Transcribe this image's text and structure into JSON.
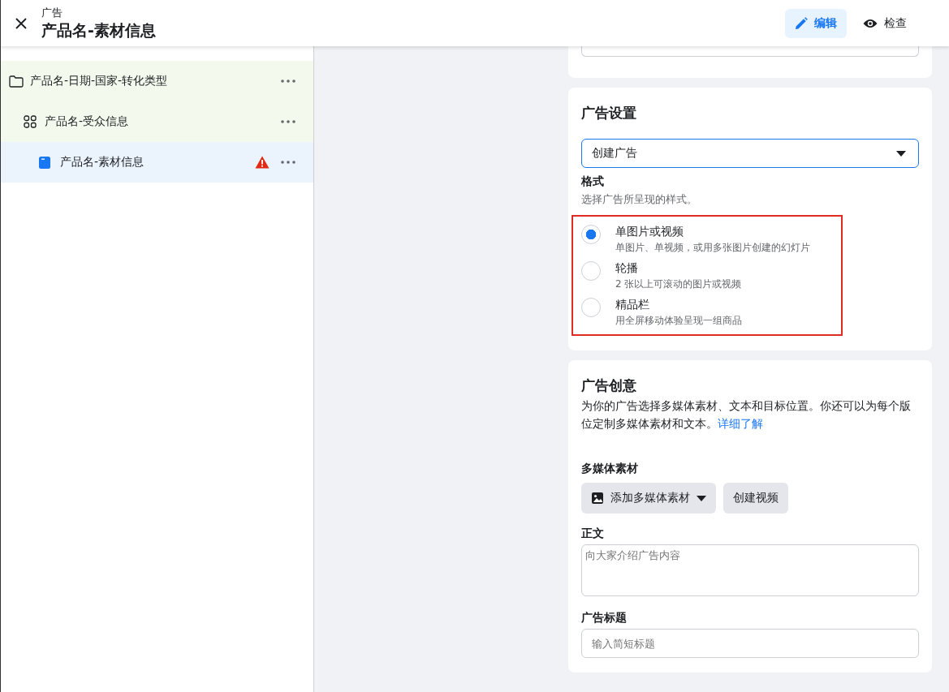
{
  "header": {
    "subtitle": "广告",
    "title": "产品名-素材信息",
    "actions": [
      {
        "kind": "edit",
        "label": "编辑",
        "selected": true
      },
      {
        "kind": "view",
        "label": "检查",
        "selected": false
      }
    ]
  },
  "tree": {
    "items": [
      {
        "kind": "campaign",
        "label": "产品名-日期-国家-转化类型",
        "selected": false,
        "warning": false,
        "children": [
          {
            "kind": "adset",
            "label": "产品名-受众信息",
            "selected": false,
            "warning": false,
            "children": [
              {
                "kind": "ad",
                "label": "产品名-素材信息",
                "selected": true,
                "warning": true
              }
            ]
          }
        ]
      }
    ]
  },
  "ad_settings": {
    "title": "广告设置",
    "dropdown": {
      "value": "创建广告"
    },
    "format_label": "格式",
    "format_hint": "选择广告所呈现的样式。",
    "options": [
      {
        "label": "单图片或视频",
        "description": "单图片、单视频，或用多张图片创建的幻灯片",
        "selected": true
      },
      {
        "label": "轮播",
        "description": "2 张以上可滚动的图片或视频",
        "selected": false
      },
      {
        "label": "精品栏",
        "description": "用全屏移动体验呈现一组商品",
        "selected": false
      }
    ]
  },
  "creative": {
    "title": "广告创意",
    "description": "为你的广告选择多媒体素材、文本和目标位置。你还可以为每个版位定制多媒体素材和文本。",
    "link": "详细了解",
    "media_label": "多媒体素材",
    "add_media_button": "添加多媒体素材",
    "create_video_button": "创建视频",
    "body_label": "正文",
    "body_placeholder": "向大家介绍广告内容",
    "headline_label": "广告标题",
    "headline_placeholder": "输入简短标题"
  }
}
